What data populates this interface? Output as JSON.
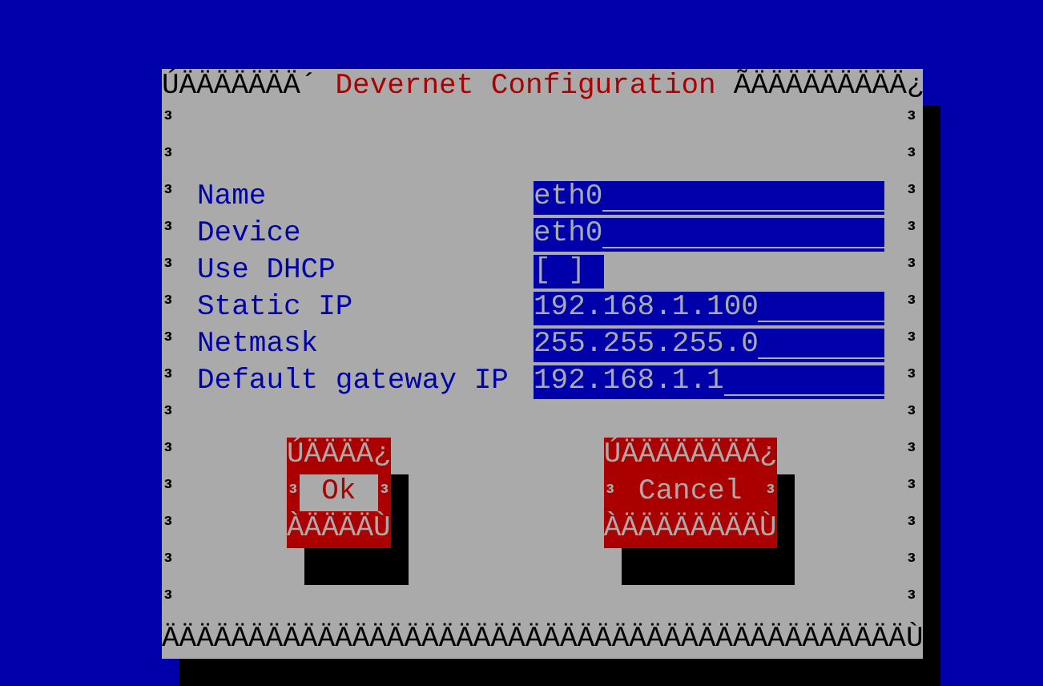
{
  "dialog": {
    "title": "Devernet Configuration",
    "top_border_left": "ÚÄÄÄÄÄÄÄ´",
    "top_border_right": "ÃÄÄÄÄÄÄÄÄÄ¿",
    "left_border": [
      "³",
      "³",
      "³",
      "³",
      "³",
      "³",
      "³",
      "³",
      "³",
      "³",
      "³",
      "³",
      "³",
      "³"
    ],
    "right_border": [
      "³",
      "³",
      "³",
      "³",
      "³",
      "³",
      "³",
      "³",
      "³",
      "³",
      "³",
      "³",
      "³",
      "³"
    ],
    "bottom_border": "ÄÄÄÄÄÄÄÄÄÄÄÄÄÄÄÄÄÄÄÄÄÄÄÄÄÄÄÄÄÄÄÄÄÄÄÄÄÄÄÄÄÄÄÙ"
  },
  "fields": [
    {
      "label": "Name",
      "kind": "text",
      "value": "eth0"
    },
    {
      "label": "Device",
      "kind": "text",
      "value": "eth0"
    },
    {
      "label": "Use DHCP",
      "kind": "checkbox",
      "checked": false,
      "text": "[ ]"
    },
    {
      "label": "Static IP",
      "kind": "text",
      "value": "192.168.1.100"
    },
    {
      "label": "Netmask",
      "kind": "text",
      "value": "255.255.255.0"
    },
    {
      "label": "Default gateway IP",
      "kind": "text",
      "value": "192.168.1.1"
    }
  ],
  "buttons": [
    {
      "label": "Ok",
      "selected": true,
      "top": "ÚÄÄÄÄ¿",
      "left": "³",
      "right": "³",
      "bottom": "ÀÄÄÄÄÙ"
    },
    {
      "label": "Cancel",
      "selected": false,
      "top": "ÚÄÄÄÄÄÄÄÄ¿",
      "left": "³",
      "right": "³",
      "bottom": "ÀÄÄÄÄÄÄÄÄÙ"
    }
  ]
}
